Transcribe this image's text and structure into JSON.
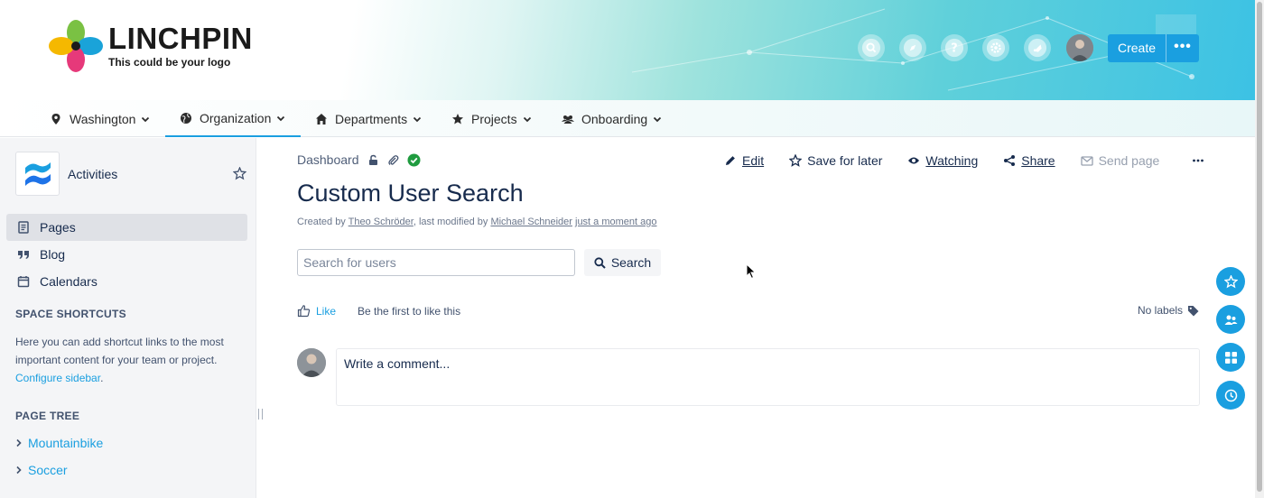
{
  "header": {
    "logo_name": "LINCHPIN",
    "logo_tagline": "This could be your logo",
    "icons": [
      "search-icon",
      "compass-icon",
      "help-icon",
      "settings-icon",
      "notification-icon"
    ],
    "create_label": "Create",
    "more_label": "•••"
  },
  "nav": {
    "items": [
      {
        "label": "Washington",
        "icon": "location-pin-icon"
      },
      {
        "label": "Organization",
        "icon": "globe-icon"
      },
      {
        "label": "Departments",
        "icon": "home-icon"
      },
      {
        "label": "Projects",
        "icon": "star-icon"
      },
      {
        "label": "Onboarding",
        "icon": "people-icon"
      }
    ],
    "active": "Organization"
  },
  "sidebar": {
    "space_name": "Activities",
    "links": [
      {
        "label": "Pages",
        "icon": "pages-icon"
      },
      {
        "label": "Blog",
        "icon": "quote-icon"
      },
      {
        "label": "Calendars",
        "icon": "calendar-icon"
      }
    ],
    "shortcuts_heading": "SPACE SHORTCUTS",
    "shortcuts_text": "Here you can add shortcut links to the most important content for your team or project.",
    "configure_link": "Configure sidebar",
    "page_tree_heading": "PAGE TREE",
    "tree": [
      {
        "label": "Mountainbike"
      },
      {
        "label": "Soccer"
      }
    ]
  },
  "page": {
    "breadcrumb": "Dashboard",
    "actions": {
      "edit": "Edit",
      "save_for_later": "Save for later",
      "watching": "Watching",
      "share": "Share",
      "send_page": "Send page"
    },
    "title": "Custom User Search",
    "byline_created": "Created by",
    "creator": "Theo Schröder",
    "byline_modified": ", last modified by",
    "modifier": "Michael Schneider",
    "modified_time": "just a moment ago",
    "search_placeholder": "Search for users",
    "search_button": "Search",
    "like_label": "Like",
    "like_text": "Be the first to like this",
    "labels_text": "No labels",
    "comment_placeholder": "Write a comment..."
  },
  "colors": {
    "accent": "#1a9fe0",
    "text": "#172b4d",
    "sidebar_bg": "#f4f5f7",
    "success": "#1f9b3f"
  }
}
